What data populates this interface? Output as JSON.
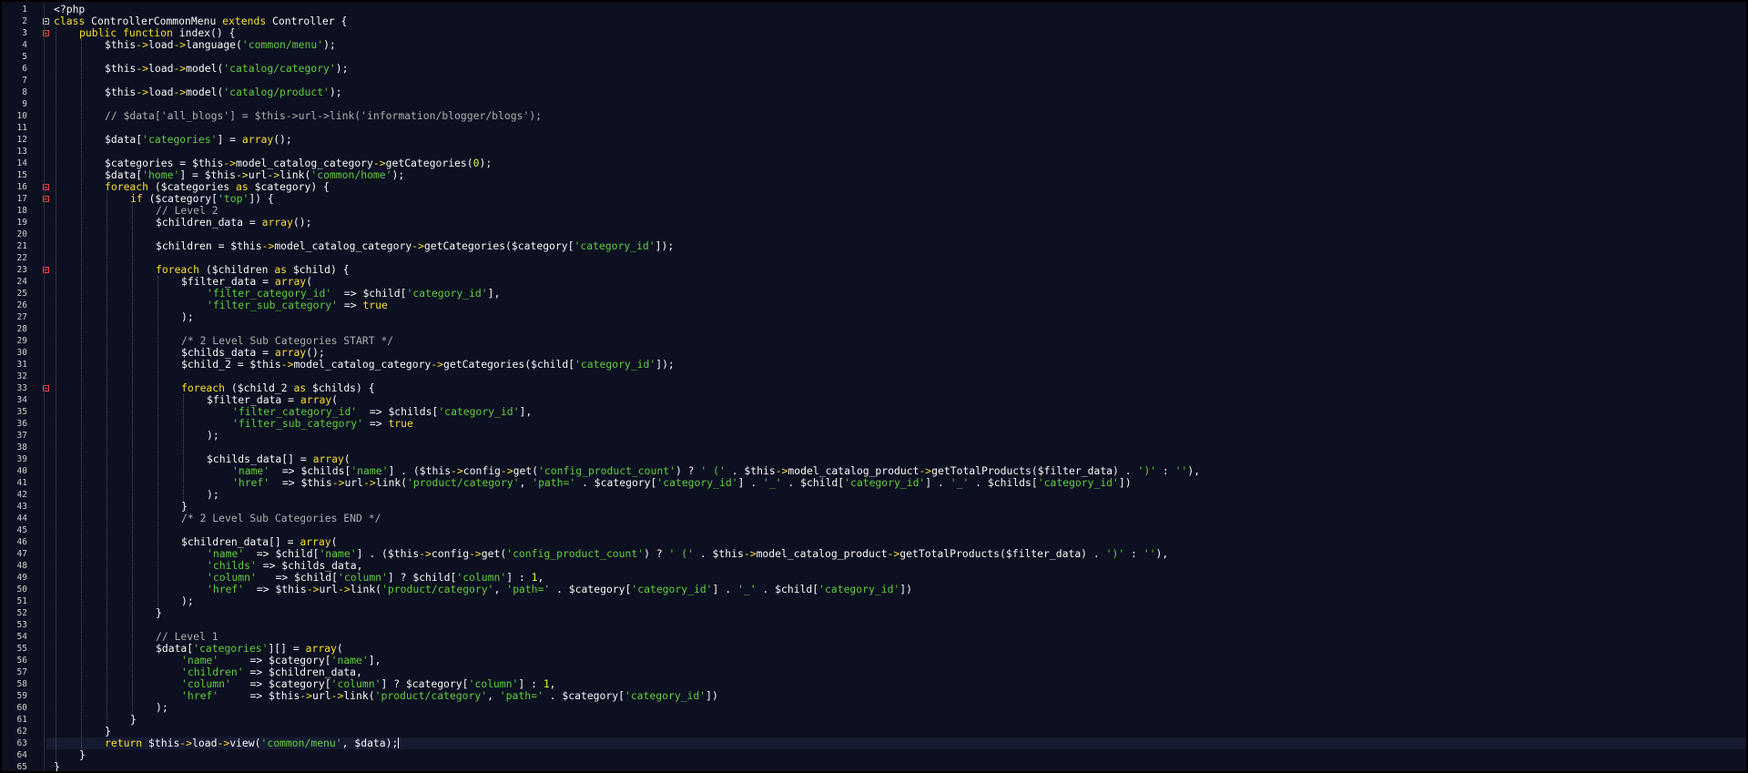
{
  "editor": {
    "language": "PHP",
    "current_line": 63,
    "colors": {
      "background": "#0c1021",
      "keyword": "#fbde2d",
      "string": "#61ce3c",
      "number": "#d8fa3c",
      "comment": "#aeaeae",
      "text": "#f8f8f8",
      "fold_marker": "#ff4040"
    },
    "lines": [
      {
        "indent": 0,
        "fold": "none",
        "text": "<?php"
      },
      {
        "indent": 0,
        "fold": "white",
        "text": "class ControllerCommonMenu extends Controller {"
      },
      {
        "indent": 1,
        "fold": "red",
        "text": "public function index() {"
      },
      {
        "indent": 2,
        "fold": "none",
        "text": "$this->load->language('common/menu');"
      },
      {
        "indent": 0,
        "fold": "none",
        "text": ""
      },
      {
        "indent": 2,
        "fold": "none",
        "text": "$this->load->model('catalog/category');"
      },
      {
        "indent": 0,
        "fold": "none",
        "text": ""
      },
      {
        "indent": 2,
        "fold": "none",
        "text": "$this->load->model('catalog/product');"
      },
      {
        "indent": 0,
        "fold": "none",
        "text": ""
      },
      {
        "indent": 2,
        "fold": "none",
        "text": "// $data['all_blogs'] = $this->url->link('information/blogger/blogs');"
      },
      {
        "indent": 0,
        "fold": "none",
        "text": ""
      },
      {
        "indent": 2,
        "fold": "none",
        "text": "$data['categories'] = array();"
      },
      {
        "indent": 0,
        "fold": "none",
        "text": ""
      },
      {
        "indent": 2,
        "fold": "none",
        "text": "$categories = $this->model_catalog_category->getCategories(0);"
      },
      {
        "indent": 2,
        "fold": "none",
        "text": "$data['home'] = $this->url->link('common/home');"
      },
      {
        "indent": 2,
        "fold": "red",
        "text": "foreach ($categories as $category) {"
      },
      {
        "indent": 3,
        "fold": "red",
        "text": "if ($category['top']) {"
      },
      {
        "indent": 4,
        "fold": "none",
        "text": "// Level 2"
      },
      {
        "indent": 4,
        "fold": "none",
        "text": "$children_data = array();"
      },
      {
        "indent": 0,
        "fold": "none",
        "text": ""
      },
      {
        "indent": 4,
        "fold": "none",
        "text": "$children = $this->model_catalog_category->getCategories($category['category_id']);"
      },
      {
        "indent": 0,
        "fold": "none",
        "text": ""
      },
      {
        "indent": 4,
        "fold": "red",
        "text": "foreach ($children as $child) {"
      },
      {
        "indent": 5,
        "fold": "none",
        "text": "$filter_data = array("
      },
      {
        "indent": 6,
        "fold": "none",
        "text": "'filter_category_id'  => $child['category_id'],"
      },
      {
        "indent": 6,
        "fold": "none",
        "text": "'filter_sub_category' => true"
      },
      {
        "indent": 5,
        "fold": "none",
        "text": ");"
      },
      {
        "indent": 0,
        "fold": "none",
        "text": ""
      },
      {
        "indent": 5,
        "fold": "none",
        "text": "/* 2 Level Sub Categories START */"
      },
      {
        "indent": 5,
        "fold": "none",
        "text": "$childs_data = array();"
      },
      {
        "indent": 5,
        "fold": "none",
        "text": "$child_2 = $this->model_catalog_category->getCategories($child['category_id']);"
      },
      {
        "indent": 0,
        "fold": "none",
        "text": ""
      },
      {
        "indent": 5,
        "fold": "red",
        "text": "foreach ($child_2 as $childs) {"
      },
      {
        "indent": 6,
        "fold": "none",
        "text": "$filter_data = array("
      },
      {
        "indent": 7,
        "fold": "none",
        "text": "'filter_category_id'  => $childs['category_id'],"
      },
      {
        "indent": 7,
        "fold": "none",
        "text": "'filter_sub_category' => true"
      },
      {
        "indent": 6,
        "fold": "none",
        "text": ");"
      },
      {
        "indent": 0,
        "fold": "none",
        "text": ""
      },
      {
        "indent": 6,
        "fold": "none",
        "text": "$childs_data[] = array("
      },
      {
        "indent": 7,
        "fold": "none",
        "text": "'name'  => $childs['name'] . ($this->config->get('config_product_count') ? ' (' . $this->model_catalog_product->getTotalProducts($filter_data) . ')' : ''),"
      },
      {
        "indent": 7,
        "fold": "none",
        "text": "'href'  => $this->url->link('product/category', 'path=' . $category['category_id'] . '_' . $child['category_id'] . '_' . $childs['category_id'])"
      },
      {
        "indent": 6,
        "fold": "none",
        "text": ");"
      },
      {
        "indent": 5,
        "fold": "none",
        "text": "}"
      },
      {
        "indent": 5,
        "fold": "none",
        "text": "/* 2 Level Sub Categories END */"
      },
      {
        "indent": 0,
        "fold": "none",
        "text": ""
      },
      {
        "indent": 5,
        "fold": "none",
        "text": "$children_data[] = array("
      },
      {
        "indent": 6,
        "fold": "none",
        "text": "'name'  => $child['name'] . ($this->config->get('config_product_count') ? ' (' . $this->model_catalog_product->getTotalProducts($filter_data) . ')' : ''),"
      },
      {
        "indent": 6,
        "fold": "none",
        "text": "'childs' => $childs_data,"
      },
      {
        "indent": 6,
        "fold": "none",
        "text": "'column'   => $child['column'] ? $child['column'] : 1,"
      },
      {
        "indent": 6,
        "fold": "none",
        "text": "'href'  => $this->url->link('product/category', 'path=' . $category['category_id'] . '_' . $child['category_id'])"
      },
      {
        "indent": 5,
        "fold": "none",
        "text": ");"
      },
      {
        "indent": 4,
        "fold": "none",
        "text": "}"
      },
      {
        "indent": 0,
        "fold": "none",
        "text": ""
      },
      {
        "indent": 4,
        "fold": "none",
        "text": "// Level 1"
      },
      {
        "indent": 4,
        "fold": "none",
        "text": "$data['categories'][] = array("
      },
      {
        "indent": 5,
        "fold": "none",
        "text": "'name'     => $category['name'],"
      },
      {
        "indent": 5,
        "fold": "none",
        "text": "'children' => $children_data,"
      },
      {
        "indent": 5,
        "fold": "none",
        "text": "'column'   => $category['column'] ? $category['column'] : 1,"
      },
      {
        "indent": 5,
        "fold": "none",
        "text": "'href'     => $this->url->link('product/category', 'path=' . $category['category_id'])"
      },
      {
        "indent": 4,
        "fold": "none",
        "text": ");"
      },
      {
        "indent": 3,
        "fold": "none",
        "text": "}"
      },
      {
        "indent": 2,
        "fold": "none",
        "text": "}"
      },
      {
        "indent": 2,
        "fold": "none",
        "text": "return $this->load->view('common/menu', $data);"
      },
      {
        "indent": 1,
        "fold": "none",
        "text": "}"
      },
      {
        "indent": 0,
        "fold": "none",
        "text": "}"
      }
    ]
  }
}
